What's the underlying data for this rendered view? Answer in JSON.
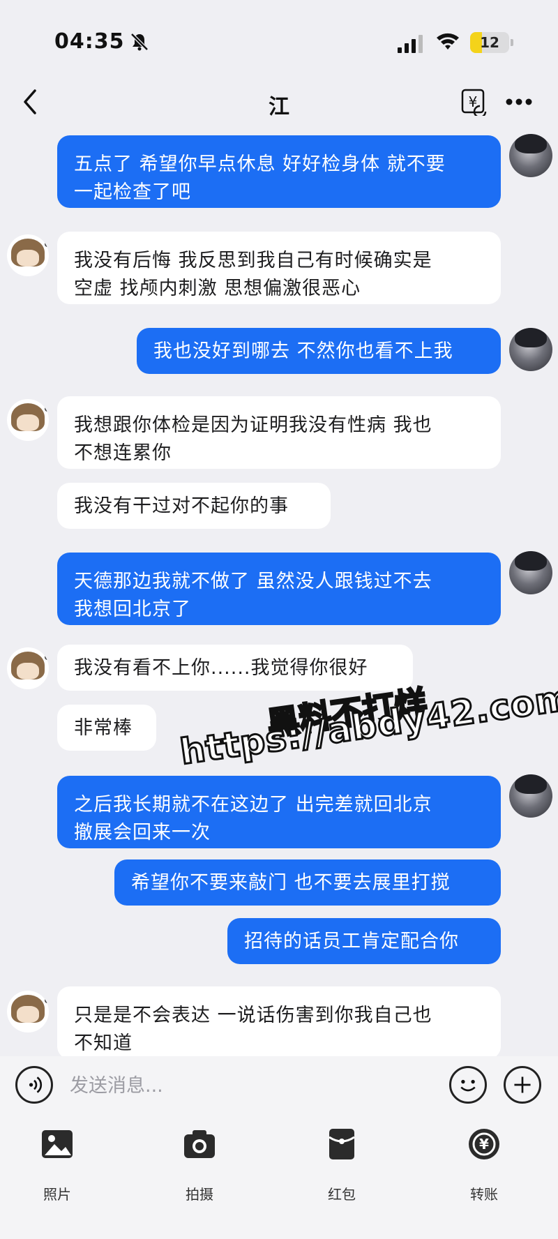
{
  "status": {
    "time": "04:35",
    "battery": "12",
    "battery_fraction": 0.12
  },
  "nav": {
    "title": "江"
  },
  "messages": [
    {
      "side": "out",
      "text": "五点了 希望你早点休息 好好检身体 就不要\n一起检查了吧"
    },
    {
      "side": "in",
      "text": "我没有后悔 我反思到我自己有时候确实是\n空虚 找颅内刺激 思想偏激很恶心"
    },
    {
      "side": "out",
      "text": "我也没好到哪去 不然你也看不上我"
    },
    {
      "side": "in",
      "text": "我想跟你体检是因为证明我没有性病 我也\n不想连累你"
    },
    {
      "side": "in",
      "text": "我没有干过对不起你的事"
    },
    {
      "side": "out",
      "text": "天德那边我就不做了 虽然没人跟钱过不去\n我想回北京了"
    },
    {
      "side": "in",
      "text": "我没有看不上你......我觉得你很好"
    },
    {
      "side": "in",
      "text": "非常棒"
    },
    {
      "side": "out",
      "text": "之后我长期就不在这边了 出完差就回北京\n撤展会回来一次"
    },
    {
      "side": "out",
      "text": "希望你不要来敲门 也不要去展里打搅"
    },
    {
      "side": "out",
      "text": "招待的话员工肯定配合你"
    },
    {
      "side": "in",
      "text": "只是是不会表达 一说话伤害到你我自己也\n不知道"
    }
  ],
  "watermark": {
    "line1": "黑料不打烊",
    "line2": "https://abdy42.com"
  },
  "composer": {
    "placeholder": "发送消息..."
  },
  "toolbar": {
    "photo": "照片",
    "camera": "拍摄",
    "red_packet": "红包",
    "transfer": "转账"
  },
  "colors": {
    "outgoing_bubble": "#1c6ef4",
    "incoming_bubble": "#ffffff",
    "background": "#efeff3"
  }
}
